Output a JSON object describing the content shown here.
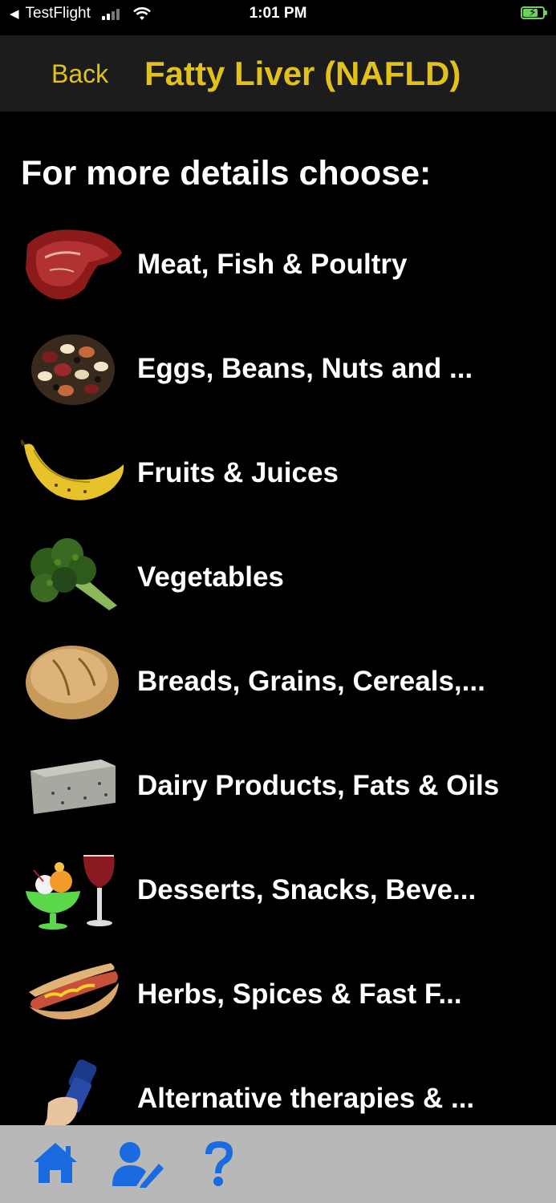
{
  "status_bar": {
    "carrier": "TestFlight",
    "time": "1:01 PM"
  },
  "nav": {
    "back_label": "Back",
    "title": "Fatty Liver (NAFLD)"
  },
  "heading": "For more details choose:",
  "categories": [
    {
      "label": "Meat, Fish & Poultry",
      "icon": "meat-steak-icon"
    },
    {
      "label": "Eggs, Beans, Nuts and ...",
      "icon": "beans-icon"
    },
    {
      "label": "Fruits & Juices",
      "icon": "banana-icon"
    },
    {
      "label": "Vegetables",
      "icon": "broccoli-icon"
    },
    {
      "label": "Breads, Grains, Cereals,...",
      "icon": "bread-loaf-icon"
    },
    {
      "label": "Dairy Products, Fats & Oils",
      "icon": "cheese-icon"
    },
    {
      "label": "Desserts, Snacks, Beve...",
      "icon": "dessert-wine-icon"
    },
    {
      "label": "Herbs, Spices & Fast F...",
      "icon": "hotdog-icon"
    },
    {
      "label": "Alternative therapies & ...",
      "icon": "dumbbell-hand-icon"
    }
  ],
  "tab_bar": {
    "items": [
      {
        "icon": "home-icon"
      },
      {
        "icon": "user-edit-icon"
      },
      {
        "icon": "help-question-icon"
      }
    ]
  },
  "colors": {
    "accent": "#e2c21a",
    "tab_icon": "#1a6be0",
    "nav_background": "#1c1c1c",
    "tab_background": "#b8b8b8"
  }
}
